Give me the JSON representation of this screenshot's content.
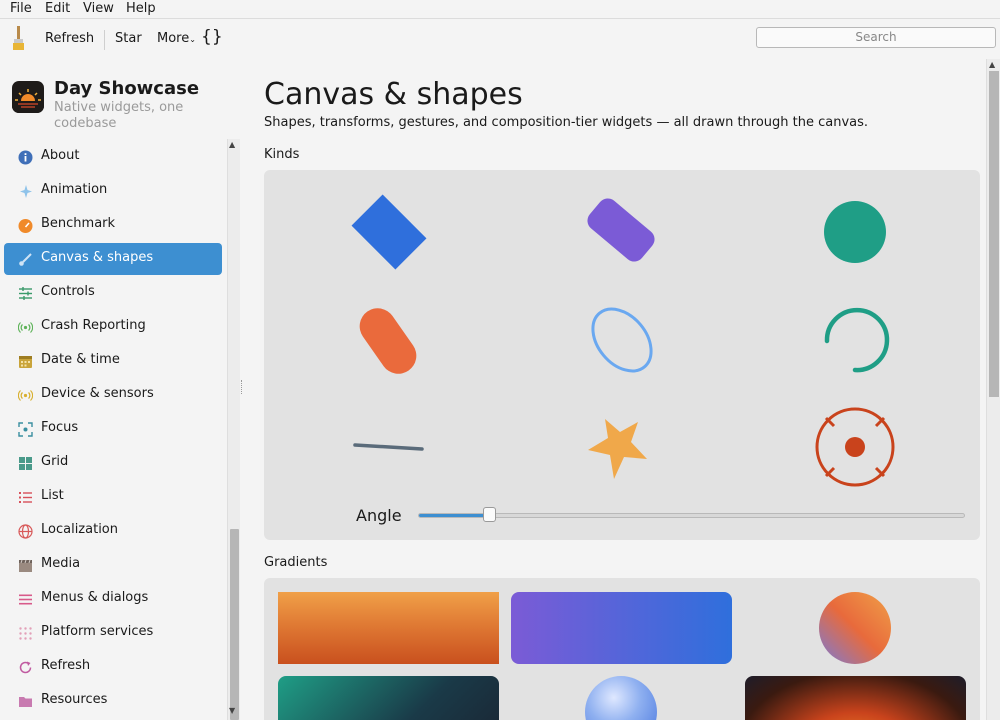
{
  "menubar": [
    "File",
    "Edit",
    "View",
    "Help"
  ],
  "toolbar": {
    "refresh": "Refresh",
    "star": "Star",
    "more": "More",
    "braces": "{}",
    "search_placeholder": "Search"
  },
  "app": {
    "title": "Day Showcase",
    "subtitle": "Native widgets, one codebase"
  },
  "sidebar": {
    "items": [
      {
        "label": "About",
        "icon": "info-icon"
      },
      {
        "label": "Animation",
        "icon": "sparkle-icon"
      },
      {
        "label": "Benchmark",
        "icon": "gauge-icon"
      },
      {
        "label": "Canvas & shapes",
        "icon": "brush-icon",
        "active": true
      },
      {
        "label": "Controls",
        "icon": "sliders-icon"
      },
      {
        "label": "Crash Reporting",
        "icon": "broadcast-icon"
      },
      {
        "label": "Date & time",
        "icon": "calendar-icon"
      },
      {
        "label": "Device & sensors",
        "icon": "sensor-icon"
      },
      {
        "label": "Focus",
        "icon": "focus-icon"
      },
      {
        "label": "Grid",
        "icon": "grid-icon"
      },
      {
        "label": "List",
        "icon": "list-icon"
      },
      {
        "label": "Localization",
        "icon": "globe-icon"
      },
      {
        "label": "Media",
        "icon": "clapper-icon"
      },
      {
        "label": "Menus & dialogs",
        "icon": "menu-icon"
      },
      {
        "label": "Platform services",
        "icon": "dots-icon"
      },
      {
        "label": "Refresh",
        "icon": "refresh-icon"
      },
      {
        "label": "Resources",
        "icon": "folder-icon"
      }
    ]
  },
  "main": {
    "title": "Canvas & shapes",
    "description": "Shapes, transforms, gestures, and composition-tier widgets — all drawn through the canvas.",
    "kinds_heading": "Kinds",
    "angle_label": "Angle",
    "angle_value": 0.13,
    "gradients_heading": "Gradients"
  },
  "colors": {
    "accent": "#3d8fd1",
    "blue": "#2f6fdc",
    "purple": "#7b5bd6",
    "teal": "#1f9e86",
    "orange": "#ea6a3c",
    "light_blue": "#6aa8f0",
    "slate": "#5a6b7a",
    "gold": "#f0a84a",
    "rust": "#c9431c"
  }
}
